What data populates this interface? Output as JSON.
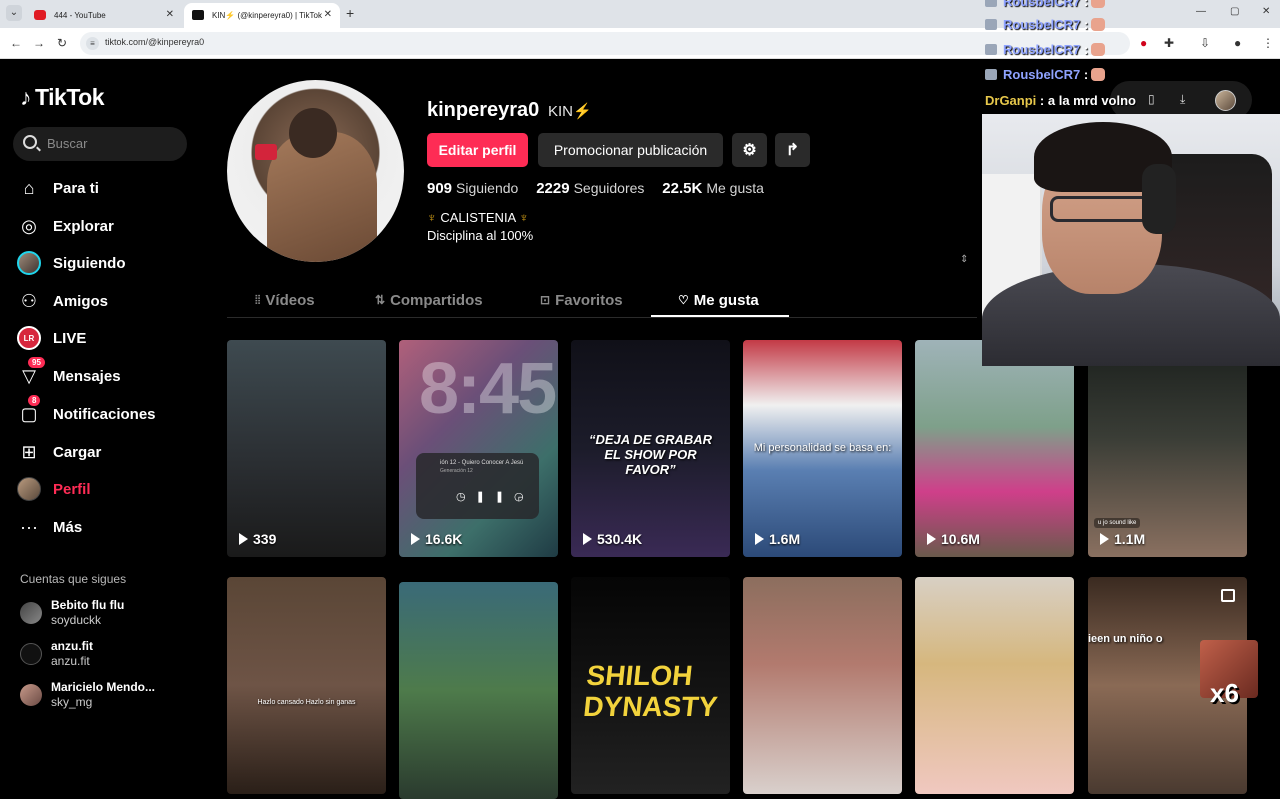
{
  "browser": {
    "tabs": [
      {
        "title": "444 - YouTube",
        "active": false
      },
      {
        "title": "KIN⚡ (@kinpereyra0) | TikTok",
        "active": true
      }
    ],
    "url": "tiktok.com/@kinpereyra0"
  },
  "tiktok": {
    "logo": "TikTok",
    "search_placeholder": "Buscar",
    "nav": [
      {
        "label": "Para ti",
        "icon": "home-icon"
      },
      {
        "label": "Explorar",
        "icon": "compass-icon"
      },
      {
        "label": "Siguiendo",
        "icon": "following-avatar-icon"
      },
      {
        "label": "Amigos",
        "icon": "friends-icon"
      },
      {
        "label": "LIVE",
        "icon": "live-icon"
      },
      {
        "label": "Mensajes",
        "icon": "messages-icon",
        "badge": "95"
      },
      {
        "label": "Notificaciones",
        "icon": "notifications-icon",
        "badge": "8"
      },
      {
        "label": "Cargar",
        "icon": "upload-icon"
      },
      {
        "label": "Perfil",
        "icon": "profile-avatar-icon",
        "active": true
      },
      {
        "label": "Más",
        "icon": "more-icon"
      }
    ],
    "live_icon_text": "LR",
    "following_title": "Cuentas que sigues",
    "following": [
      {
        "name": "Bebito flu flu",
        "user": "soyduckk"
      },
      {
        "name": "anzu.fit",
        "user": "anzu.fit"
      },
      {
        "name": "Maricielo Mendo...",
        "user": "sky_mg"
      }
    ]
  },
  "profile": {
    "username": "kinpereyra0",
    "nickname": "KIN⚡",
    "edit_label": "Editar perfil",
    "promote_label": "Promocionar publicación",
    "stats": {
      "following_count": "909",
      "following_label": "Siguiendo",
      "followers_count": "2229",
      "followers_label": "Seguidores",
      "likes_count": "22.5K",
      "likes_label": "Me gusta"
    },
    "bio_line1": "CALISTENIA",
    "bio_line2": "Disciplina al 100%",
    "tabs": [
      "Vídeos",
      "Compartidos",
      "Favoritos",
      "Me gusta"
    ],
    "active_tab": "Me gusta"
  },
  "videos": [
    {
      "views": "339"
    },
    {
      "views": "16.6K",
      "overlay": "8:45",
      "player_title": "ión 12 - Quiero Conocer A Jesú",
      "player_sub": "Generación 12"
    },
    {
      "views": "530.4K",
      "caption": "“DEJA DE GRABAR EL SHOW POR FAVOR”"
    },
    {
      "views": "1.6M",
      "caption": "Mi personalidad se basa en:"
    },
    {
      "views": "10.6M"
    },
    {
      "views": "1.1M",
      "caption": "u jo sound like"
    },
    {
      "views": "",
      "caption": "Hazlo cansado Hazlo sin ganas"
    },
    {
      "views": ""
    },
    {
      "views": "",
      "caption": "SHILOH DYNASTY"
    },
    {
      "views": ""
    },
    {
      "views": ""
    },
    {
      "views": "",
      "caption": "ieen un niño o"
    }
  ],
  "stream": {
    "chat": [
      {
        "user": "RousbelCR7",
        "text": ":"
      },
      {
        "user": "RousbelCR7",
        "text": ":"
      },
      {
        "user": "RousbelCR7",
        "text": ":"
      },
      {
        "user": "RousbelCR7",
        "text": ":"
      },
      {
        "user": "DrGanpi",
        "text": ": a la mrd volno"
      }
    ],
    "emote_multiplier": "x6"
  }
}
